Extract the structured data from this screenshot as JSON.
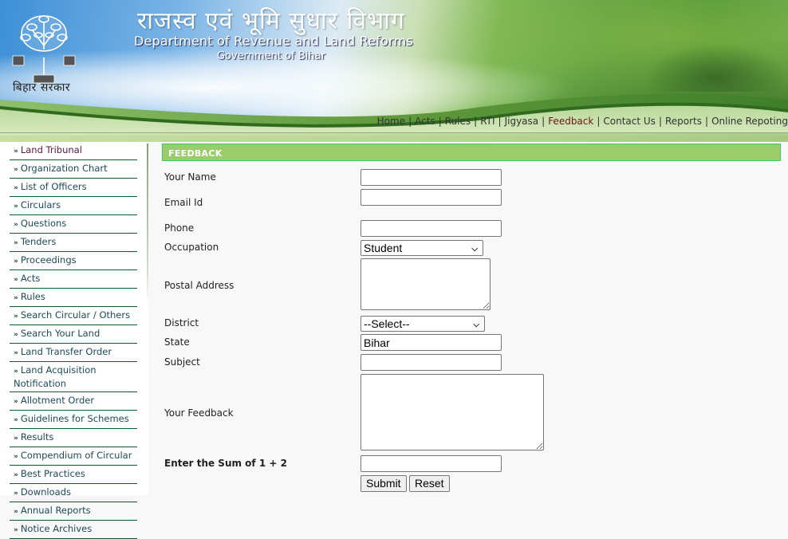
{
  "header": {
    "title_hindi": "राजस्व एवं भूमि सुधार विभाग",
    "title_english": "Department of Revenue and Land Reforms",
    "subtitle": "Government of Bihar",
    "logo_caption": "बिहार सरकार",
    "logo_icon": "bodhi-tree-emblem-icon"
  },
  "topnav": {
    "items": [
      {
        "label": "Home",
        "active": false
      },
      {
        "label": "Acts",
        "active": false
      },
      {
        "label": "Rules",
        "active": false
      },
      {
        "label": "RTI",
        "active": false
      },
      {
        "label": "Jigyasa",
        "active": false
      },
      {
        "label": "Feedback",
        "active": true
      },
      {
        "label": "Contact Us",
        "active": false
      },
      {
        "label": "Reports",
        "active": false
      },
      {
        "label": "Online Repoting",
        "active": false
      }
    ],
    "separator": "|"
  },
  "sidebar": {
    "bullet": "»",
    "items": [
      {
        "label": "Land Tribunal"
      },
      {
        "label": "Organization Chart"
      },
      {
        "label": "List of Officers"
      },
      {
        "label": "Circulars"
      },
      {
        "label": "Questions"
      },
      {
        "label": "Tenders"
      },
      {
        "label": "Proceedings"
      },
      {
        "label": "Acts"
      },
      {
        "label": "Rules"
      },
      {
        "label": "Search Circular / Others"
      },
      {
        "label": "Search Your Land"
      },
      {
        "label": "Land Transfer Order"
      },
      {
        "label": "Land Acquisition Notification"
      },
      {
        "label": "Allotment Order"
      },
      {
        "label": "Guidelines for Schemes"
      },
      {
        "label": "Results"
      },
      {
        "label": "Compendium of Circular"
      },
      {
        "label": "Best Practices"
      },
      {
        "label": "Downloads"
      },
      {
        "label": "Annual Reports"
      },
      {
        "label": "Notice Archives"
      }
    ]
  },
  "form": {
    "heading": "FEEDBACK",
    "fields": {
      "name": {
        "label": "Your Name",
        "value": ""
      },
      "email": {
        "label": "Email Id",
        "value": ""
      },
      "phone": {
        "label": "Phone",
        "value": ""
      },
      "occupation": {
        "label": "Occupation",
        "selected": "Student"
      },
      "address": {
        "label": "Postal Address",
        "value": ""
      },
      "district": {
        "label": "District",
        "selected": "--Select--"
      },
      "state": {
        "label": "State",
        "value": "Bihar"
      },
      "subject": {
        "label": "Subject",
        "value": ""
      },
      "feedback": {
        "label": "Your Feedback",
        "value": ""
      },
      "captcha": {
        "label": "Enter the Sum of 1 + 2",
        "value": ""
      }
    },
    "submit_label": "Submit",
    "reset_label": "Reset"
  },
  "colors": {
    "section_header_bg": "#9acd6a",
    "section_header_border": "#3dcc66",
    "sidebar_rule": "#0d5a2a",
    "active_nav": "#6b1a1a"
  }
}
